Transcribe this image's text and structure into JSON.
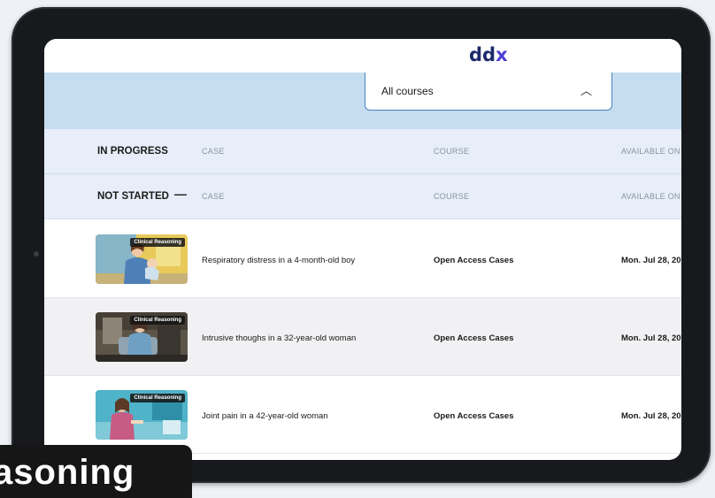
{
  "app": {
    "logo_text": "ddx",
    "logo_accent": "x"
  },
  "filter": {
    "selected": "All courses",
    "chevron_icon": "chevron-up-icon"
  },
  "sections": [
    {
      "title": "IN PROGRESS",
      "col_case": "CASE",
      "col_course": "COURSE",
      "col_available": "AVAILABLE ON",
      "collapse_icon": ""
    },
    {
      "title": "NOT STARTED",
      "col_case": "CASE",
      "col_course": "COURSE",
      "col_available": "AVAILABLE ON",
      "collapse_icon": "—"
    }
  ],
  "rows": [
    {
      "tag": "Clinical Reasoning",
      "case": "Respiratory distress in a 4-month-old boy",
      "course": "Open Access Cases",
      "available": "Mon. Jul 28, 20"
    },
    {
      "tag": "Clinical Reasoning",
      "case": "Intrusive thoughs in a 32-year-old woman",
      "course": "Open Access Cases",
      "available": "Mon. Jul 28, 20"
    },
    {
      "tag": "Clinical Reasoning",
      "case": "Joint pain in a 42-year-old woman",
      "course": "Open Access Cases",
      "available": "Mon. Jul 28, 20"
    }
  ],
  "caption": "asoning",
  "colors": {
    "brand": "#1d2a6b",
    "accent": "#4b3fd6",
    "band": "#c6dcef",
    "section": "#e7eef9",
    "dropdown_border": "#3f86c3"
  }
}
